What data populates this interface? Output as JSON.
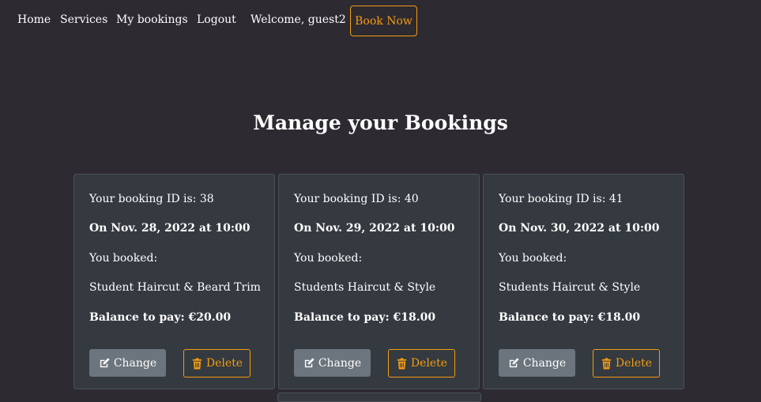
{
  "nav": {
    "home": "Home",
    "services": "Services",
    "my_bookings": "My bookings",
    "logout": "Logout",
    "welcome": "Welcome, guest2",
    "book_now": "Book Now"
  },
  "page_title": "Manage your Bookings",
  "bookings": [
    {
      "id_text": "Your booking ID is: 38",
      "date_text": "On Nov. 28, 2022 at 10:00",
      "booked_label": "You booked:",
      "service": "Student Haircut & Beard Trim",
      "balance_text": "Balance to pay: €20.00",
      "change_label": "Change",
      "delete_label": "Delete"
    },
    {
      "id_text": "Your booking ID is: 40",
      "date_text": "On Nov. 29, 2022 at 10:00",
      "booked_label": "You booked:",
      "service": "Students Haircut & Style",
      "balance_text": "Balance to pay: €18.00",
      "change_label": "Change",
      "delete_label": "Delete"
    },
    {
      "id_text": "Your booking ID is: 41",
      "date_text": "On Nov. 30, 2022 at 10:00",
      "booked_label": "You booked:",
      "service": "Students Haircut & Style",
      "balance_text": "Balance to pay: €18.00",
      "change_label": "Change",
      "delete_label": "Delete"
    }
  ],
  "icons": {
    "change": "edit-icon",
    "delete": "trash-icon"
  },
  "colors": {
    "background": "#2e2a31",
    "card": "#343a40",
    "accent": "#f39c12",
    "secondary_button": "#6c757d"
  }
}
